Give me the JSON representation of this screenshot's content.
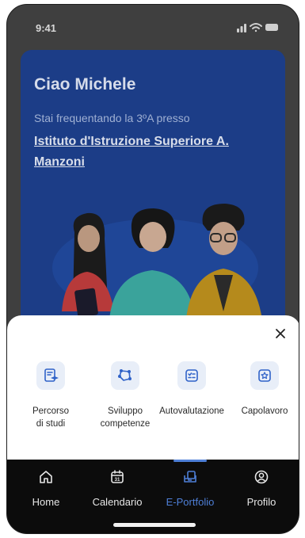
{
  "status": {
    "time": "9:41"
  },
  "card": {
    "greeting": "Ciao Michele",
    "subtitle": "Stai frequentando la 3ºA presso",
    "school": "Istituto d'Istruzione Superiore A. Manzoni"
  },
  "sheet": {
    "actions": [
      {
        "label": "Percorso\ndi studi",
        "icon": "document-hat-icon"
      },
      {
        "label": "Sviluppo\ncompetenze",
        "icon": "network-icon"
      },
      {
        "label": "Autovalutazione",
        "icon": "checklist-icon"
      },
      {
        "label": "Capolavoro",
        "icon": "star-badge-icon"
      }
    ]
  },
  "tabbar": {
    "tabs": [
      {
        "label": "Home",
        "icon": "home-icon"
      },
      {
        "label": "Calendario",
        "icon": "calendar-icon",
        "day": "31"
      },
      {
        "label": "E-Portfolio",
        "icon": "portfolio-icon",
        "active": true
      },
      {
        "label": "Profilo",
        "icon": "profile-icon"
      }
    ]
  },
  "colors": {
    "accent": "#4e7fd7",
    "card": "#1c3d87",
    "tile": "#e8eef8"
  }
}
